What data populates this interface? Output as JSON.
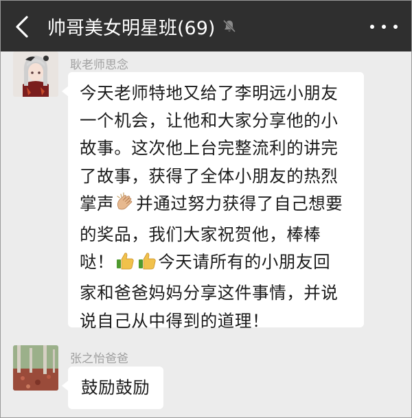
{
  "header": {
    "title": "帅哥美女明星班(69)",
    "back_icon": "chevron-left-icon",
    "mute_icon": "bell-muted-icon",
    "more_icon": "more-dots-icon"
  },
  "colors": {
    "header_bg": "#2f2f2f",
    "chat_bg": "#ececec",
    "bubble_bg": "#ffffff",
    "sender_name": "#a0a0a0"
  },
  "messages": [
    {
      "sender": "耿老师思念",
      "avatar": "anime-girl-avatar",
      "lines": [
        "今天老师特地又给了李明远小朋友",
        "一个机会，让他和大家分享他的小",
        "故事。这次他上台完整流利的讲完",
        "了故事，获得了全体小朋友的热烈",
        "掌声",
        "并通过努力获得了自己想要",
        "的奖品，我们大家祝贺他，棒棒",
        "哒！",
        "今天请所有的小朋友回",
        "家和爸爸妈妈分享这件事情，并说",
        "说自己从中得到的道理！"
      ],
      "emojis": [
        "clapping-hands-emoji",
        "thumbs-up-emoji",
        "thumbs-up-emoji"
      ]
    },
    {
      "sender": "张之怡爸爸",
      "avatar": "autumn-trees-avatar",
      "text": "鼓励鼓励"
    }
  ]
}
